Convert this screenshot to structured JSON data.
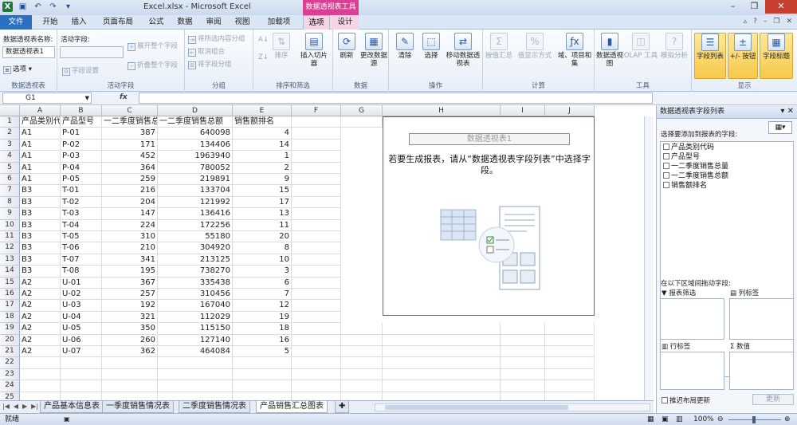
{
  "window": {
    "title": "Excel.xlsx - Microsoft Excel",
    "context_tab": "数据透视表工具"
  },
  "tabs": [
    "文件",
    "开始",
    "插入",
    "页面布局",
    "公式",
    "数据",
    "审阅",
    "视图",
    "加载项",
    "选项",
    "设计"
  ],
  "ribbon": {
    "pivot_name_label": "数据透视表名称:",
    "pivot_name_value": "数据透视表1",
    "options_btn": "选项",
    "active_field_label": "活动字段:",
    "field_settings": "字段设置",
    "expand_field": "展开整个字段",
    "collapse_field": "折叠整个字段",
    "group_selection": "将所选内容分组",
    "ungroup": "取消组合",
    "group_field": "将字段分组",
    "sort": "排序",
    "insert_slicer": "插入切片器",
    "refresh": "刷新",
    "change_source": "更改数据源",
    "clear": "清除",
    "select": "选择",
    "move_pivot": "移动数据透视表",
    "summarize_by": "按值汇总",
    "show_values_as": "值显示方式",
    "fields_items": "域、项目和集",
    "pivot_chart": "数据透视图",
    "olap_tools": "OLAP 工具",
    "what_if": "模拟分析",
    "field_list": "字段列表",
    "buttons": "+/- 按钮",
    "field_headers": "字段标题",
    "groups": [
      "数据透视表",
      "活动字段",
      "分组",
      "排序和筛选",
      "数据",
      "操作",
      "计算",
      "工具",
      "显示"
    ]
  },
  "formula_bar": {
    "name_box": "G1",
    "fx": "fx",
    "value": ""
  },
  "columns": [
    "A",
    "B",
    "C",
    "D",
    "E",
    "F",
    "G",
    "H",
    "I",
    "J"
  ],
  "headers": [
    "产品类别代码",
    "产品型号",
    "一二季度销售总量",
    "一二季度销售总额",
    "销售额排名"
  ],
  "rows": [
    [
      "A1",
      "P-01",
      "387",
      "640098",
      "4"
    ],
    [
      "A1",
      "P-02",
      "171",
      "134406",
      "14"
    ],
    [
      "A1",
      "P-03",
      "452",
      "1963940",
      "1"
    ],
    [
      "A1",
      "P-04",
      "364",
      "780052",
      "2"
    ],
    [
      "A1",
      "P-05",
      "259",
      "219891",
      "9"
    ],
    [
      "B3",
      "T-01",
      "216",
      "133704",
      "15"
    ],
    [
      "B3",
      "T-02",
      "204",
      "121992",
      "17"
    ],
    [
      "B3",
      "T-03",
      "147",
      "136416",
      "13"
    ],
    [
      "B3",
      "T-04",
      "224",
      "172256",
      "11"
    ],
    [
      "B3",
      "T-05",
      "310",
      "55180",
      "20"
    ],
    [
      "B3",
      "T-06",
      "210",
      "304920",
      "8"
    ],
    [
      "B3",
      "T-07",
      "341",
      "213125",
      "10"
    ],
    [
      "B3",
      "T-08",
      "195",
      "738270",
      "3"
    ],
    [
      "A2",
      "U-01",
      "367",
      "335438",
      "6"
    ],
    [
      "A2",
      "U-02",
      "257",
      "310456",
      "7"
    ],
    [
      "A2",
      "U-03",
      "192",
      "167040",
      "12"
    ],
    [
      "A2",
      "U-04",
      "321",
      "112029",
      "19"
    ],
    [
      "A2",
      "U-05",
      "350",
      "115150",
      "18"
    ],
    [
      "A2",
      "U-06",
      "260",
      "127140",
      "16"
    ],
    [
      "A2",
      "U-07",
      "362",
      "464084",
      "5"
    ]
  ],
  "row_numbers": [
    "1",
    "2",
    "3",
    "4",
    "5",
    "6",
    "7",
    "8",
    "9",
    "10",
    "11",
    "12",
    "13",
    "14",
    "15",
    "16",
    "17",
    "18",
    "19",
    "20",
    "21",
    "22",
    "23",
    "24",
    "25"
  ],
  "pivot": {
    "placeholder_title": "数据透视表1",
    "message": "若要生成报表，请从“数据透视表字段列表”中选择字段。"
  },
  "sheet_tabs": [
    "产品基本信息表",
    "一季度销售情况表",
    "二季度销售情况表",
    "产品销售汇总图表"
  ],
  "status": {
    "ready": "就绪",
    "zoom": "100%"
  },
  "field_panel": {
    "title": "数据透视表字段列表",
    "choose_label": "选择要添加到报表的字段:",
    "fields": [
      "产品类别代码",
      "产品型号",
      "一二季度销售总量",
      "一二季度销售总额",
      "销售额排名"
    ],
    "drag_label": "在以下区域间拖动字段:",
    "report_filter": "报表筛选",
    "column_labels": "列标签",
    "row_labels": "行标签",
    "values": "数值",
    "defer_update": "推迟布局更新",
    "update_btn": "更新"
  }
}
